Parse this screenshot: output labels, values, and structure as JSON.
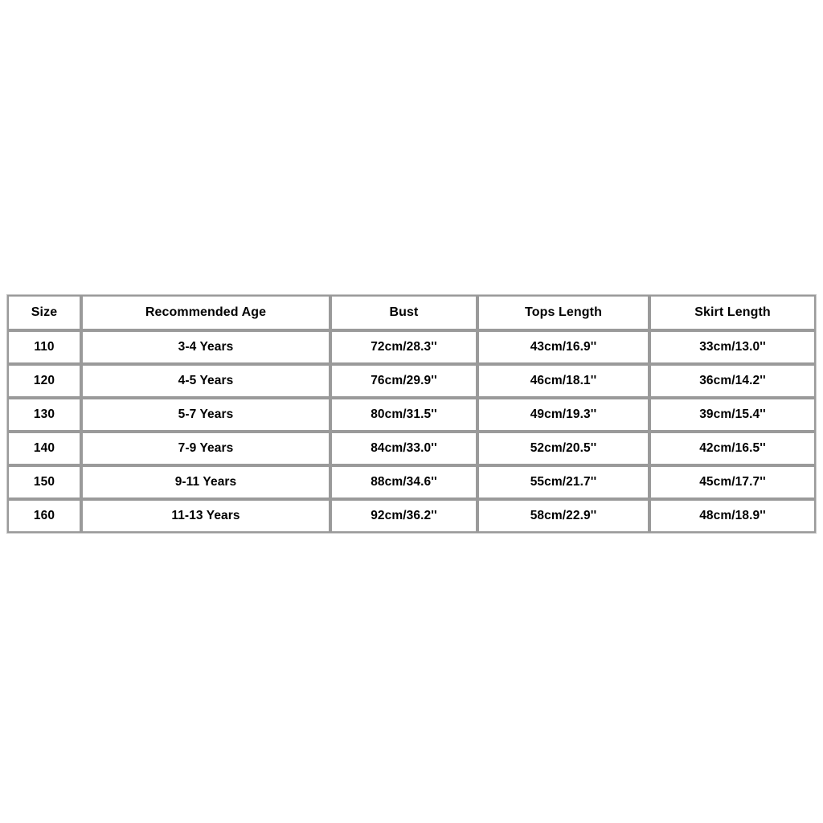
{
  "table": {
    "headers": [
      "Size",
      "Recommended Age",
      "Bust",
      "Tops Length",
      "Skirt Length"
    ],
    "rows": [
      {
        "size": "110",
        "age": "3-4 Years",
        "bust": "72cm/28.3''",
        "tops_length": "43cm/16.9''",
        "skirt_length": "33cm/13.0''"
      },
      {
        "size": "120",
        "age": "4-5 Years",
        "bust": "76cm/29.9''",
        "tops_length": "46cm/18.1''",
        "skirt_length": "36cm/14.2''"
      },
      {
        "size": "130",
        "age": "5-7 Years",
        "bust": "80cm/31.5''",
        "tops_length": "49cm/19.3''",
        "skirt_length": "39cm/15.4''"
      },
      {
        "size": "140",
        "age": "7-9 Years",
        "bust": "84cm/33.0''",
        "tops_length": "52cm/20.5''",
        "skirt_length": "42cm/16.5''"
      },
      {
        "size": "150",
        "age": "9-11 Years",
        "bust": "88cm/34.6''",
        "tops_length": "55cm/21.7''",
        "skirt_length": "45cm/17.7''"
      },
      {
        "size": "160",
        "age": "11-13 Years",
        "bust": "92cm/36.2''",
        "tops_length": "58cm/22.9''",
        "skirt_length": "48cm/18.9''"
      }
    ]
  },
  "colors": {
    "page_background": "#ffffff",
    "cell_background": "#ffffff",
    "cell_border": "#9a9a9a",
    "table_frame": "#c8c8c8",
    "text": "#000000"
  }
}
